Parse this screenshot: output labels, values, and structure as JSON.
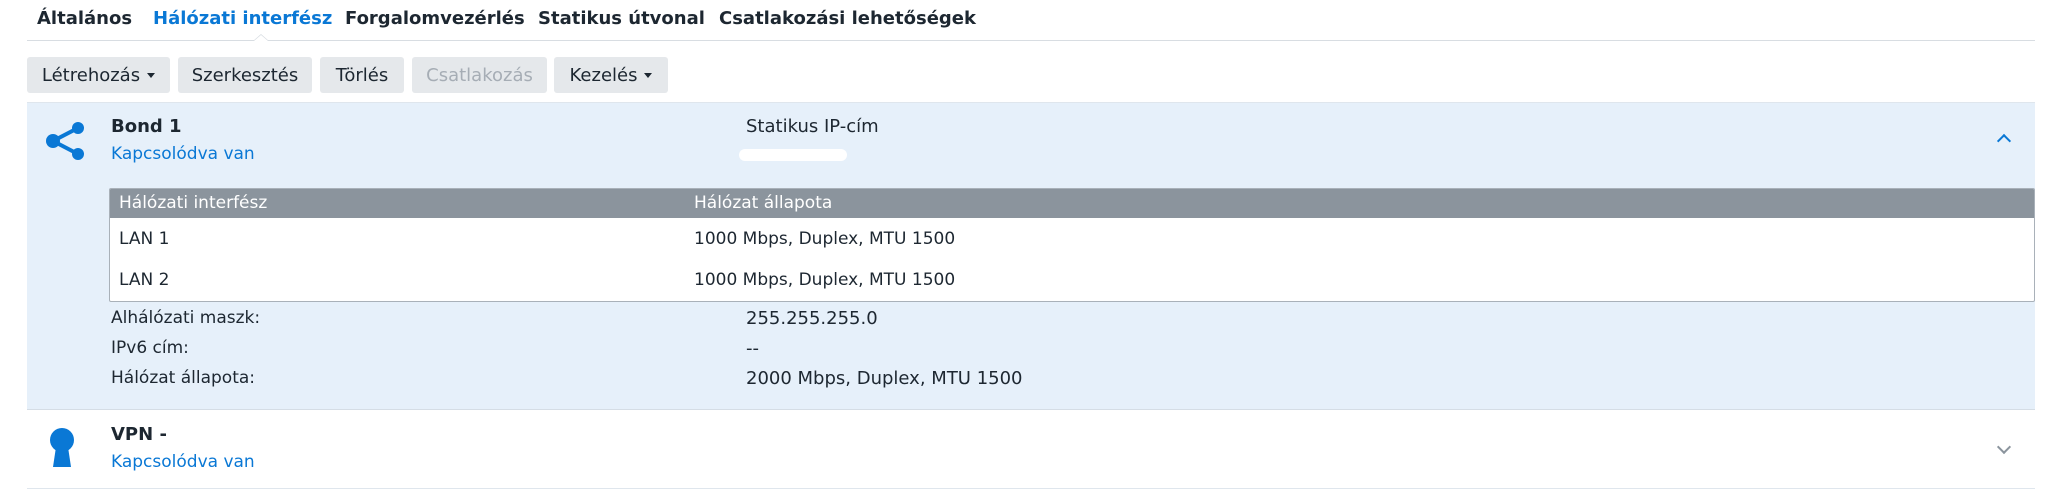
{
  "tabs": [
    {
      "label": "Általános"
    },
    {
      "label": "Hálózati interfész"
    },
    {
      "label": "Forgalomvezérlés"
    },
    {
      "label": "Statikus útvonal"
    },
    {
      "label": "Csatlakozási lehetőségek"
    }
  ],
  "active_tab": "Hálózati interfész",
  "toolbar": {
    "create_label": "Létrehozás",
    "edit_label": "Szerkesztés",
    "delete_label": "Törlés",
    "connect_label": "Csatlakozás",
    "manage_label": "Kezelés"
  },
  "bond": {
    "name": "Bond 1",
    "status": "Kapcsolódva van",
    "ip_mode": "Statikus IP-cím",
    "icon": "share-icon",
    "table": {
      "headers": [
        "Hálózati interfész",
        "Hálózat állapota"
      ],
      "rows": [
        [
          "LAN 1",
          "1000 Mbps, Duplex, MTU 1500"
        ],
        [
          "LAN 2",
          "1000 Mbps, Duplex, MTU 1500"
        ]
      ]
    },
    "details": [
      {
        "label": "Alhálózati maszk:",
        "value": "255.255.255.0"
      },
      {
        "label": "IPv6 cím:",
        "value": "--"
      },
      {
        "label": "Hálózat állapota:",
        "value": "2000 Mbps, Duplex, MTU 1500"
      }
    ]
  },
  "vpn": {
    "name": "VPN -",
    "status": "Kapcsolódva van",
    "icon": "keyhole-icon"
  },
  "colors": {
    "accent": "#0a78d5",
    "expanded_bg": "#e6f0fa",
    "table_header": "#8b949d",
    "button_bg": "#e5e8eb"
  }
}
